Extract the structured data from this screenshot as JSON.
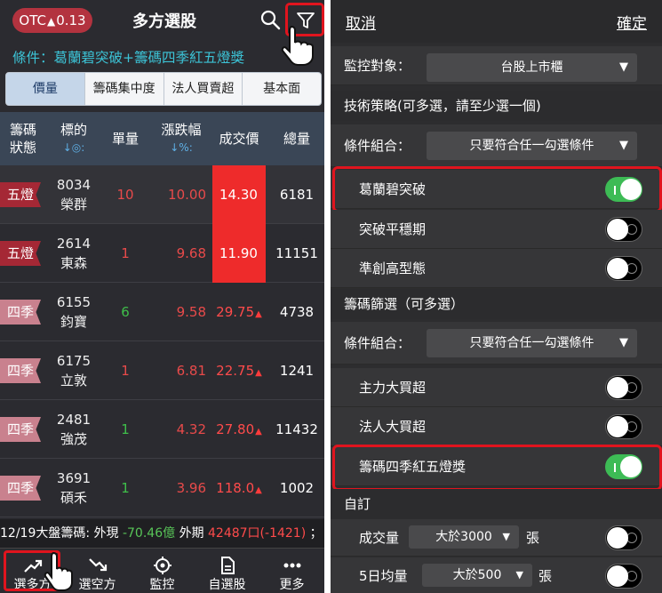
{
  "left": {
    "otc_label": "OTC",
    "otc_arrow": "▲",
    "otc_value": "0.13",
    "title": "多方選股",
    "condition": "條件：葛蘭碧突破+籌碼四季紅五燈獎",
    "tabs": [
      "價量",
      "籌碼集中度",
      "法人買賣超",
      "基本面"
    ],
    "headers": {
      "status_line1": "籌碼",
      "status_line2": "狀態",
      "stock_line1": "標的",
      "stock_sub": "↓◎:",
      "volume": "單量",
      "change_line1": "漲跌幅",
      "change_sub": "↓%:",
      "price": "成交價",
      "total": "總量"
    },
    "rows": [
      {
        "badge": "五燈",
        "code": "8034",
        "name": "榮群",
        "volume": "10",
        "change": "10.00",
        "price": "14.30",
        "up": "",
        "total": "6181"
      },
      {
        "badge": "五燈",
        "code": "2614",
        "name": "東森",
        "volume": "1",
        "change": "9.68",
        "price": "11.90",
        "up": "",
        "total": "11151"
      },
      {
        "badge": "四季",
        "code": "6155",
        "name": "鈞寶",
        "volume": "6",
        "change": "9.58",
        "price": "29.75",
        "up": "▲",
        "total": "4738"
      },
      {
        "badge": "四季",
        "code": "6175",
        "name": "立敦",
        "volume": "1",
        "change": "6.81",
        "price": "22.75",
        "up": "▲",
        "total": "1241"
      },
      {
        "badge": "四季",
        "code": "2481",
        "name": "強茂",
        "volume": "1",
        "change": "4.32",
        "price": "27.80",
        "up": "▲",
        "total": "11432"
      },
      {
        "badge": "四季",
        "code": "3691",
        "name": "碩禾",
        "volume": "1",
        "change": "3.96",
        "price": "118.0",
        "up": "▲",
        "total": "1002"
      }
    ],
    "ticker": {
      "prefix": "12/19大盤籌碼: 外現",
      "value1": "-70.46億",
      "mid": "外期",
      "value2": "42487口(-1421)",
      "suffix": "；"
    },
    "nav": [
      "選多方",
      "選空方",
      "監控",
      "自選股",
      "更多"
    ],
    "colors": {
      "accent_red": "#e0141e",
      "cyan": "#3cc3d6",
      "up_red": "#e84a4a",
      "down_green": "#3fbf4a"
    }
  },
  "right": {
    "cancel": "取消",
    "confirm": "確定",
    "monitor_label": "監控對象：",
    "monitor_value": "台股上市櫃",
    "tech_section": "技術策略(可多選，請至少選一個)",
    "combo_label": "條件組合：",
    "combo_value": "只要符合任一勾選條件",
    "tech_items": [
      {
        "label": "葛蘭碧突破",
        "on": true
      },
      {
        "label": "突破平穩期",
        "on": false
      },
      {
        "label": "準創高型態",
        "on": false
      }
    ],
    "chip_section": "籌碼篩選（可多選）",
    "chip_combo_label": "條件組合：",
    "chip_combo_value": "只要符合任一勾選條件",
    "chip_items": [
      {
        "label": "主力大買超",
        "on": false
      },
      {
        "label": "法人大買超",
        "on": false
      },
      {
        "label": "籌碼四季紅五燈獎",
        "on": true
      }
    ],
    "custom_section": "自訂",
    "custom_items": [
      {
        "label": "成交量",
        "value": "大於3000",
        "unit": "張",
        "on": false
      },
      {
        "label": "5日均量",
        "value": "大於500",
        "unit": "張",
        "on": false
      }
    ]
  }
}
